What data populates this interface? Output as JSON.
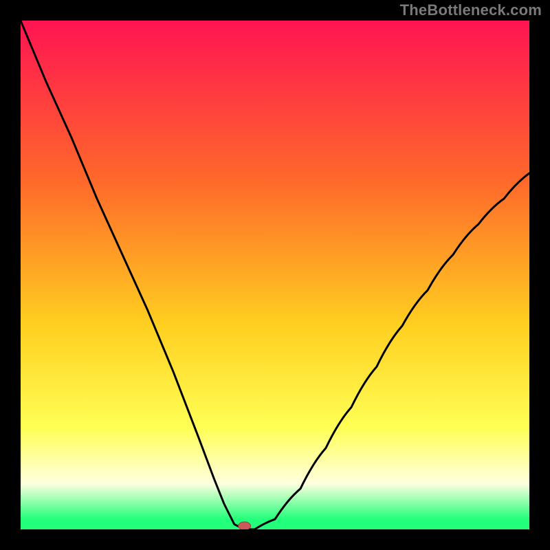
{
  "watermark": "TheBottleneck.com",
  "colors": {
    "frame_bg": "#000000",
    "watermark": "#7a7a7a",
    "gradient_top": "#ff1452",
    "gradient_mid1": "#ff6a2a",
    "gradient_mid2": "#ffd020",
    "gradient_lower": "#ffff55",
    "gradient_pale": "#ffffe0",
    "gradient_green": "#22ff7a",
    "curve": "#000000",
    "marker_fill": "#c85a5a",
    "marker_stroke": "#9c3f3f"
  },
  "chart_data": {
    "type": "line",
    "title": "",
    "xlabel": "",
    "ylabel": "",
    "xlim": [
      0,
      1
    ],
    "ylim": [
      0,
      1
    ],
    "notes": "V-shaped bottleneck curve over rainbow gradient; minimum near x≈0.44",
    "curve": {
      "name": "bottleneck-curve",
      "x": [
        0.0,
        0.05,
        0.1,
        0.15,
        0.2,
        0.25,
        0.3,
        0.35,
        0.38,
        0.4,
        0.42,
        0.44,
        0.46,
        0.5,
        0.55,
        0.6,
        0.65,
        0.7,
        0.75,
        0.8,
        0.85,
        0.9,
        0.95,
        1.0
      ],
      "y": [
        1.0,
        0.88,
        0.77,
        0.65,
        0.54,
        0.43,
        0.31,
        0.18,
        0.1,
        0.05,
        0.01,
        0.0,
        0.0,
        0.02,
        0.08,
        0.16,
        0.24,
        0.32,
        0.4,
        0.47,
        0.54,
        0.6,
        0.65,
        0.7
      ]
    },
    "marker": {
      "x": 0.44,
      "y": 0.0
    },
    "gradient_stops": [
      {
        "offset": 0.0,
        "color": "#ff1452"
      },
      {
        "offset": 0.32,
        "color": "#ff6a2a"
      },
      {
        "offset": 0.6,
        "color": "#ffd020"
      },
      {
        "offset": 0.8,
        "color": "#ffff55"
      },
      {
        "offset": 0.91,
        "color": "#ffffe0"
      },
      {
        "offset": 0.98,
        "color": "#22ff7a"
      },
      {
        "offset": 1.0,
        "color": "#22ff7a"
      }
    ]
  }
}
